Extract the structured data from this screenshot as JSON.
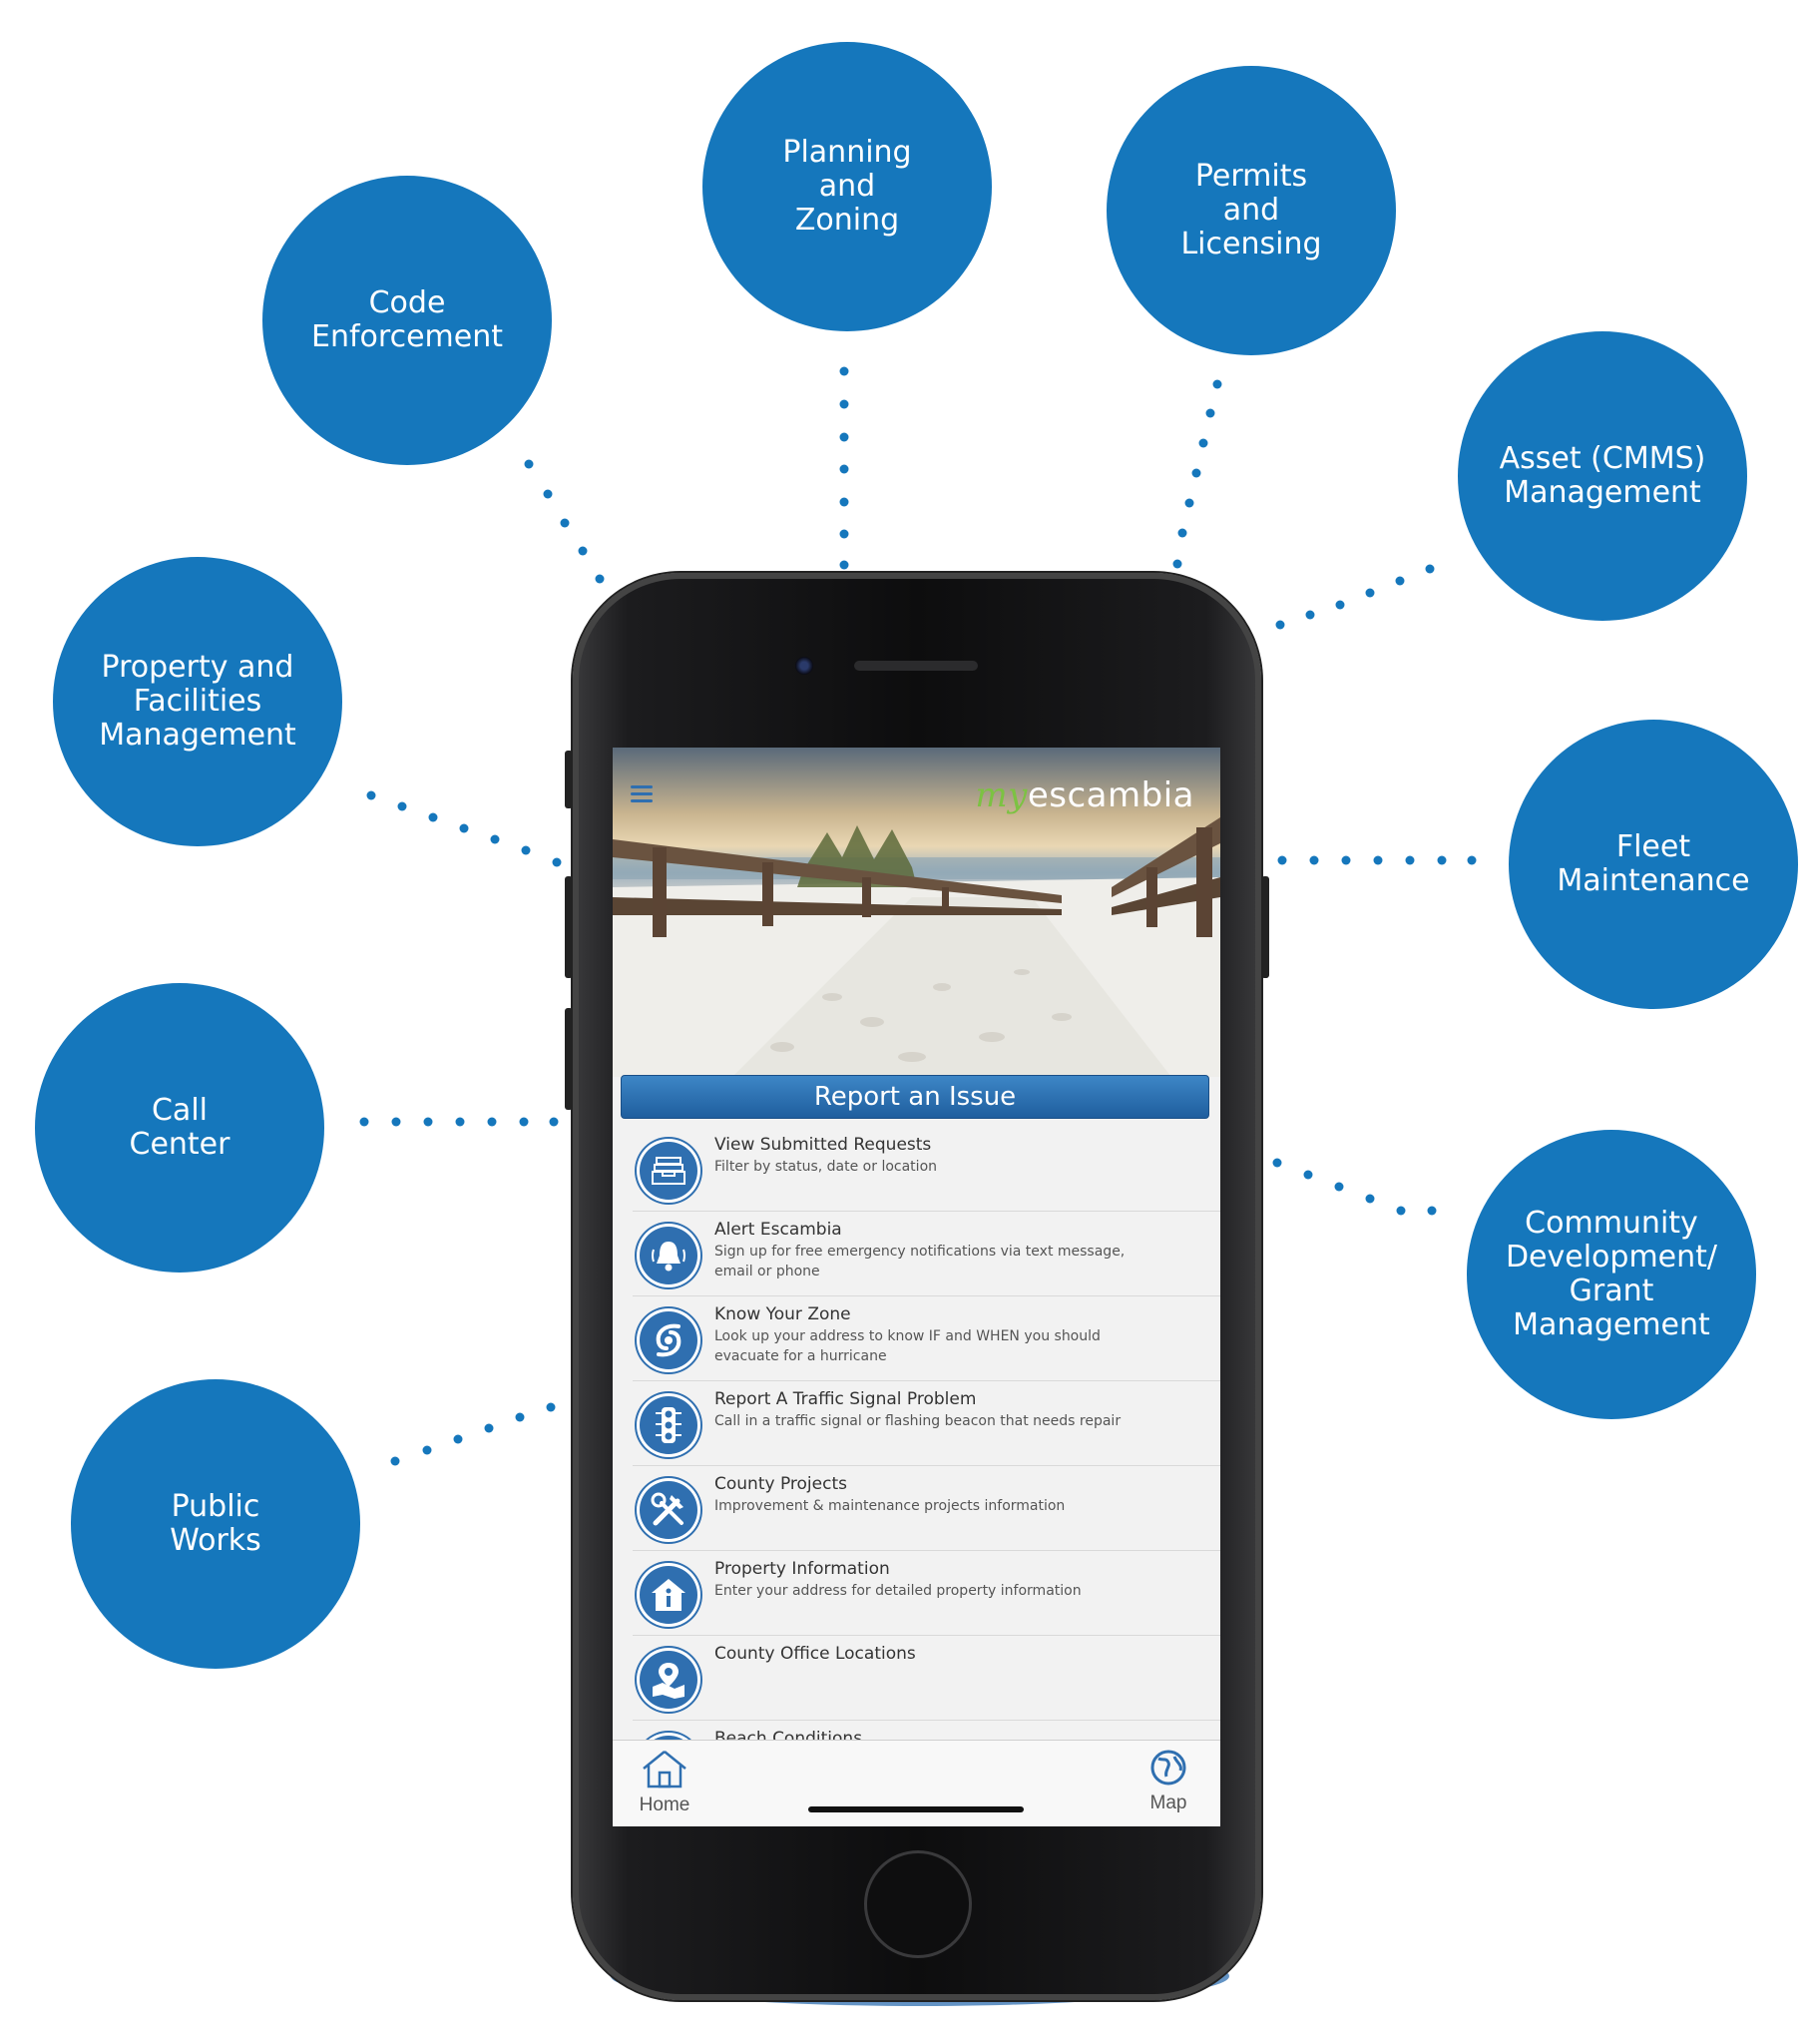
{
  "circles": [
    {
      "id": "code-enforcement",
      "label": "Code\nEnforcement"
    },
    {
      "id": "planning-zoning",
      "label": "Planning\nand\nZoning"
    },
    {
      "id": "permits-licensing",
      "label": "Permits\nand\nLicensing"
    },
    {
      "id": "asset-management",
      "label": "Asset (CMMS)\nManagement"
    },
    {
      "id": "property-facilities",
      "label": "Property and\nFacilities\nManagement"
    },
    {
      "id": "fleet-maintenance",
      "label": "Fleet\nMaintenance"
    },
    {
      "id": "call-center",
      "label": "Call\nCenter"
    },
    {
      "id": "community-development",
      "label": "Community\nDevelopment/\nGrant\nManagement"
    },
    {
      "id": "public-works",
      "label": "Public\nWorks"
    }
  ],
  "colors": {
    "accent": "#1577bc",
    "app_blue": "#2f6fb0",
    "logo_green": "#7cc242"
  },
  "app": {
    "logo_my": "my",
    "logo_name": "escambia",
    "report_button": "Report an Issue",
    "items": [
      {
        "title": "View Submitted Requests",
        "subtitle": "Filter by status, date or location",
        "icon": "inbox-tray-icon"
      },
      {
        "title": "Alert Escambia",
        "subtitle": "Sign up for free emergency notifications via text message, email or phone",
        "icon": "bell-icon"
      },
      {
        "title": "Know Your Zone",
        "subtitle": "Look up your address to know IF and WHEN you should evacuate for a hurricane",
        "icon": "hurricane-icon"
      },
      {
        "title": "Report A Traffic Signal Problem",
        "subtitle": "Call in a traffic signal or flashing beacon that needs repair",
        "icon": "traffic-light-icon"
      },
      {
        "title": "County Projects",
        "subtitle": "Improvement & maintenance projects information",
        "icon": "tools-icon"
      },
      {
        "title": "Property Information",
        "subtitle": "Enter your address for detailed property information",
        "icon": "house-info-icon"
      },
      {
        "title": "County Office Locations",
        "subtitle": "",
        "icon": "map-pin-icon"
      },
      {
        "title": "Beach Conditions",
        "subtitle": "",
        "icon": "beach-icon"
      }
    ],
    "tabs": {
      "home": "Home",
      "map": "Map"
    }
  }
}
